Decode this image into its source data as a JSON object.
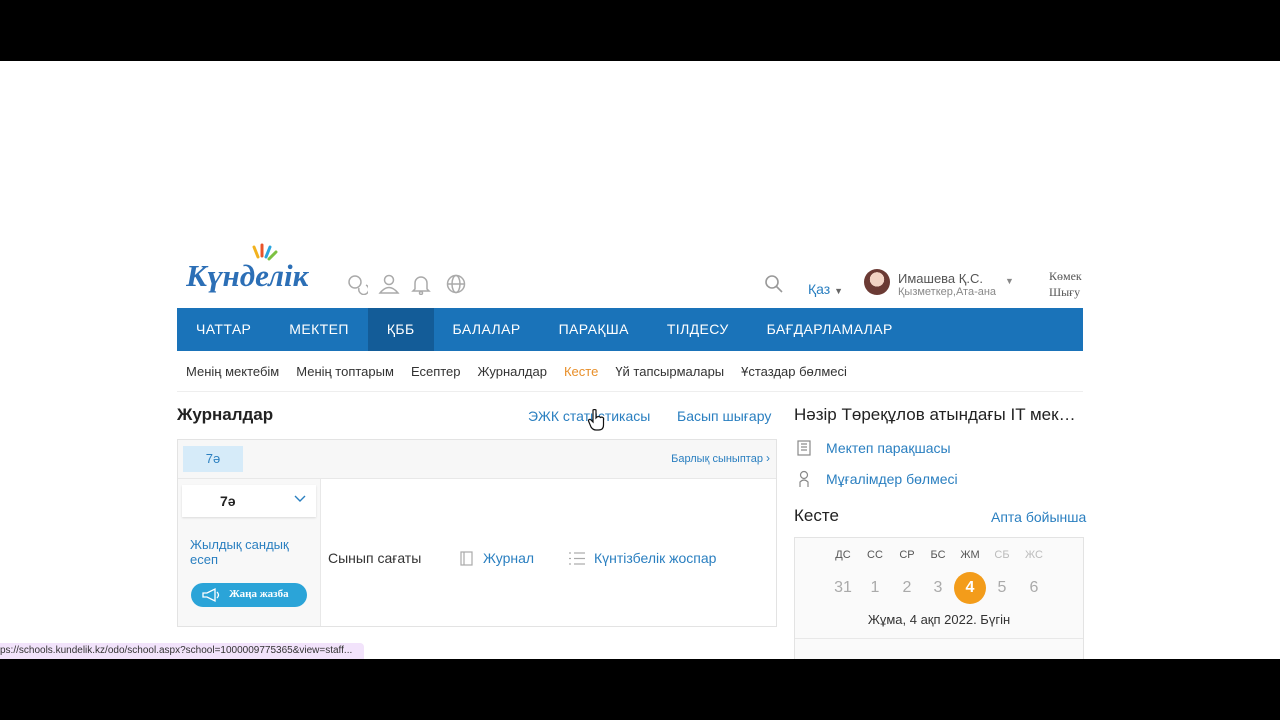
{
  "header": {
    "logo_text": "Күнделік",
    "language": "Қаз",
    "user_name": "Имашева Қ.С.",
    "user_role": "Қызметкер,Ата-ана",
    "help_line1": "Көмек",
    "help_line2": "Шығу"
  },
  "nav": {
    "items": [
      "ЧАТТАР",
      "МЕКТЕП",
      "ҚББ",
      "БАЛАЛАР",
      "ПАРАҚША",
      "ТІЛДЕСУ",
      "БАҒДАРЛАМАЛАР"
    ],
    "active": "ҚББ"
  },
  "subnav": {
    "items": [
      "Менің мектебім",
      "Менің топтарым",
      "Есептер",
      "Журналдар",
      "Кесте",
      "Үй тапсырмалары",
      "Ұстаздар бөлмесі"
    ],
    "active": "Кесте"
  },
  "main": {
    "title": "Журналдар",
    "stats_link": "ЭЖК статистикасы",
    "print_link": "Басып шығару",
    "class_chip": "7ә",
    "all_classes": "Барлық сыныптар",
    "class_select": "7ә",
    "annual_report": "Жылдық сандық есеп",
    "new_entry": "Жаңа жазба",
    "class_hour": "Сынып сағаты",
    "journal": "Журнал",
    "calendar_plan": "Күнтізбелік жоспар"
  },
  "right": {
    "school_name": "Нәзір Төреқұлов атындағы IT мек…",
    "school_page": "Мектеп парақшасы",
    "teachers_room": "Мұғалімдер бөлмесі",
    "schedule_title": "Кесте",
    "by_week": "Апта бойынша",
    "day_names": [
      "ДС",
      "СС",
      "СР",
      "БС",
      "ЖМ",
      "СБ",
      "ЖС"
    ],
    "day_numbers": [
      "31",
      "1",
      "2",
      "3",
      "4",
      "5",
      "6"
    ],
    "today_index": 4,
    "date_text": "Жұма, 4 ақп 2022. Бүгін"
  },
  "status_url": "ps://schools.kundelik.kz/odo/school.aspx?school=1000009775365&view=staff...",
  "colors": {
    "nav_bg": "#1a73b9",
    "nav_active": "#135c98",
    "link": "#2a7fc0",
    "today": "#f39c1a",
    "active_sub": "#e88f2a"
  }
}
